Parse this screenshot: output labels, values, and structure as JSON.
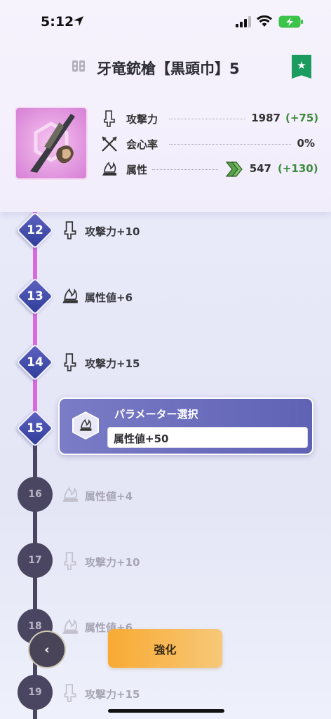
{
  "status_bar": {
    "time": "5:12"
  },
  "header": {
    "title": "牙竜銃槍【黒頭巾】5",
    "weapon_type_icon": "gunlance-icon",
    "favorite_icon": "star-bookmark-icon"
  },
  "stats": [
    {
      "icon": "attack-blade-icon",
      "label": "攻撃力",
      "value": "1987",
      "bonus": "(+75)"
    },
    {
      "icon": "affinity-icon",
      "label": "会心率",
      "value": "0%",
      "bonus": ""
    },
    {
      "icon": "element-flame-icon",
      "label": "属性",
      "value": "547",
      "bonus": "(+130)",
      "element_icon": "wind-chevron-icon"
    }
  ],
  "timeline": {
    "unlocked": [
      {
        "level": "12",
        "icon": "attack-blade-icon",
        "label": "攻撃力+10"
      },
      {
        "level": "13",
        "icon": "element-flame-icon",
        "label": "属性値+6"
      },
      {
        "level": "14",
        "icon": "attack-blade-icon",
        "label": "攻撃力+15"
      },
      {
        "level": "15",
        "icon": "element-flame-icon",
        "label": ""
      }
    ],
    "locked": [
      {
        "level": "16",
        "icon": "element-flame-icon",
        "label": "属性値+4"
      },
      {
        "level": "17",
        "icon": "attack-blade-icon",
        "label": "攻撃力+10"
      },
      {
        "level": "18",
        "icon": "element-flame-icon",
        "label": "属性値+6"
      },
      {
        "level": "19",
        "icon": "attack-blade-icon",
        "label": "攻撃力+15"
      }
    ]
  },
  "param_select": {
    "title": "パラメーター選択",
    "selected": "属性値+50"
  },
  "footer": {
    "enhance_label": "強化",
    "back_label": "‹"
  },
  "colors": {
    "accent_purple": "#5f62b4",
    "node_blue": "#2f3d9a",
    "progress_line": "#d86ae0",
    "locked_line": "#4a4560",
    "enhance_orange": "#f8aa32",
    "favorite_green": "#1b9b5e",
    "bonus_green": "#3d8a3d"
  }
}
